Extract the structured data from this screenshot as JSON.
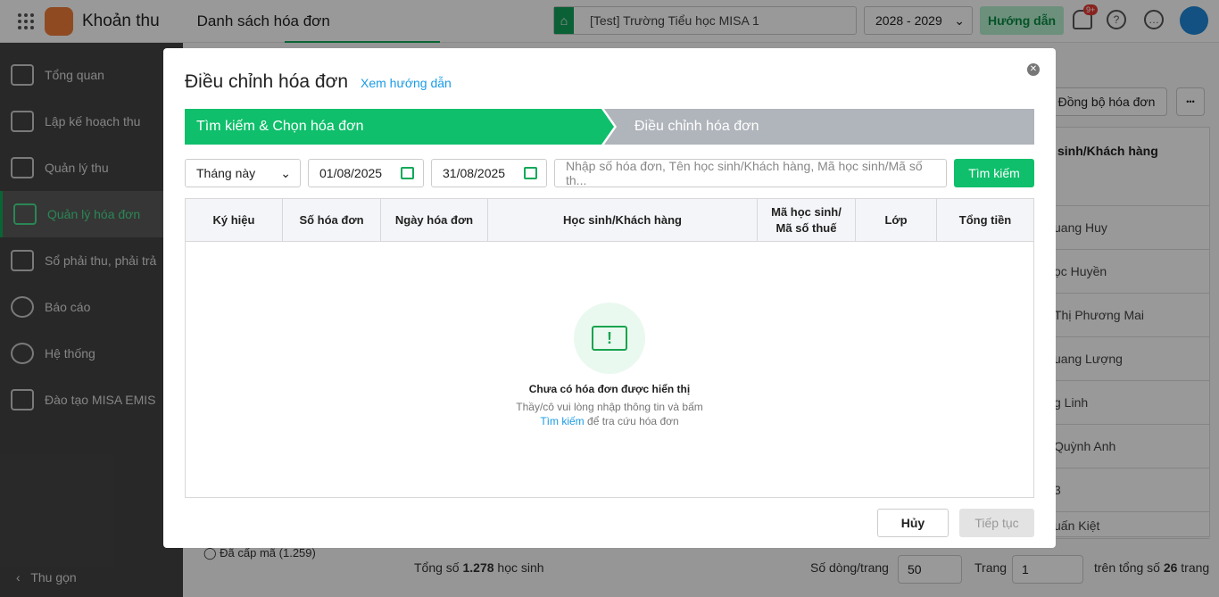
{
  "app": {
    "name": "Khoản thu",
    "page_title": "Danh sách hóa đơn",
    "school": "[Test] Trường Tiểu học MISA 1",
    "year": "2028 - 2029",
    "guide": "Hướng dẫn",
    "notif_badge": "9+"
  },
  "sidebar": {
    "items": [
      {
        "label": "Tổng quan"
      },
      {
        "label": "Lập kế hoạch thu"
      },
      {
        "label": "Quản lý thu"
      },
      {
        "label": "Quản lý hóa đơn",
        "active": true
      },
      {
        "label": "Sổ phải thu, phải trả"
      },
      {
        "label": "Báo cáo"
      },
      {
        "label": "Hệ thống"
      },
      {
        "label": "Đào tạo MISA EMIS"
      }
    ],
    "collapse": "Thu gọn"
  },
  "background": {
    "sync_button": "Đồng bộ hóa đơn",
    "more_button": "•••",
    "column_header": "sinh/Khách hàng",
    "rows": [
      "uang Huy",
      "ọc Huyền",
      "Thị Phương Mai",
      "uang Lượng",
      "g Linh",
      "Quỳnh Anh",
      "3",
      "uấn Kiệt"
    ],
    "filter_option": "Đã cấp mã (1.259)",
    "total_prefix": "Tổng số ",
    "total_count": "1.278",
    "total_suffix": " học sinh",
    "rows_per_page_label": "Số dòng/trang",
    "rows_per_page": "50",
    "page_label": "Trang",
    "page": "1",
    "page_total_prefix": "trên tổng số ",
    "page_total": "26",
    "page_total_suffix": " trang"
  },
  "modal": {
    "title": "Điều chỉnh hóa đơn",
    "help_link": "Xem hướng dẫn",
    "steps": [
      "Tìm kiếm & Chọn hóa đơn",
      "Điều chỉnh hóa đơn"
    ],
    "period": "Tháng này",
    "from_date": "01/08/2025",
    "to_date": "31/08/2025",
    "search_placeholder": "Nhập số hóa đơn, Tên học sinh/Khách hàng, Mã học sinh/Mã số th...",
    "search_button": "Tìm kiếm",
    "columns": [
      "Ký hiệu",
      "Số hóa đơn",
      "Ngày hóa đơn",
      "Học sinh/Khách hàng",
      "Mã học sinh/ Mã số thuế",
      "Lớp",
      "Tổng tiền"
    ],
    "empty": {
      "title": "Chưa có hóa đơn được hiển thị",
      "line1": "Thầy/cô vui lòng nhập thông tin và bấm",
      "link": "Tìm kiếm",
      "line2": " để tra cứu hóa đơn"
    },
    "cancel": "Hủy",
    "next": "Tiếp tục"
  },
  "colors": {
    "primary": "#0fbf6b",
    "link": "#1a9be6",
    "step_inactive": "#b0b4bb"
  }
}
